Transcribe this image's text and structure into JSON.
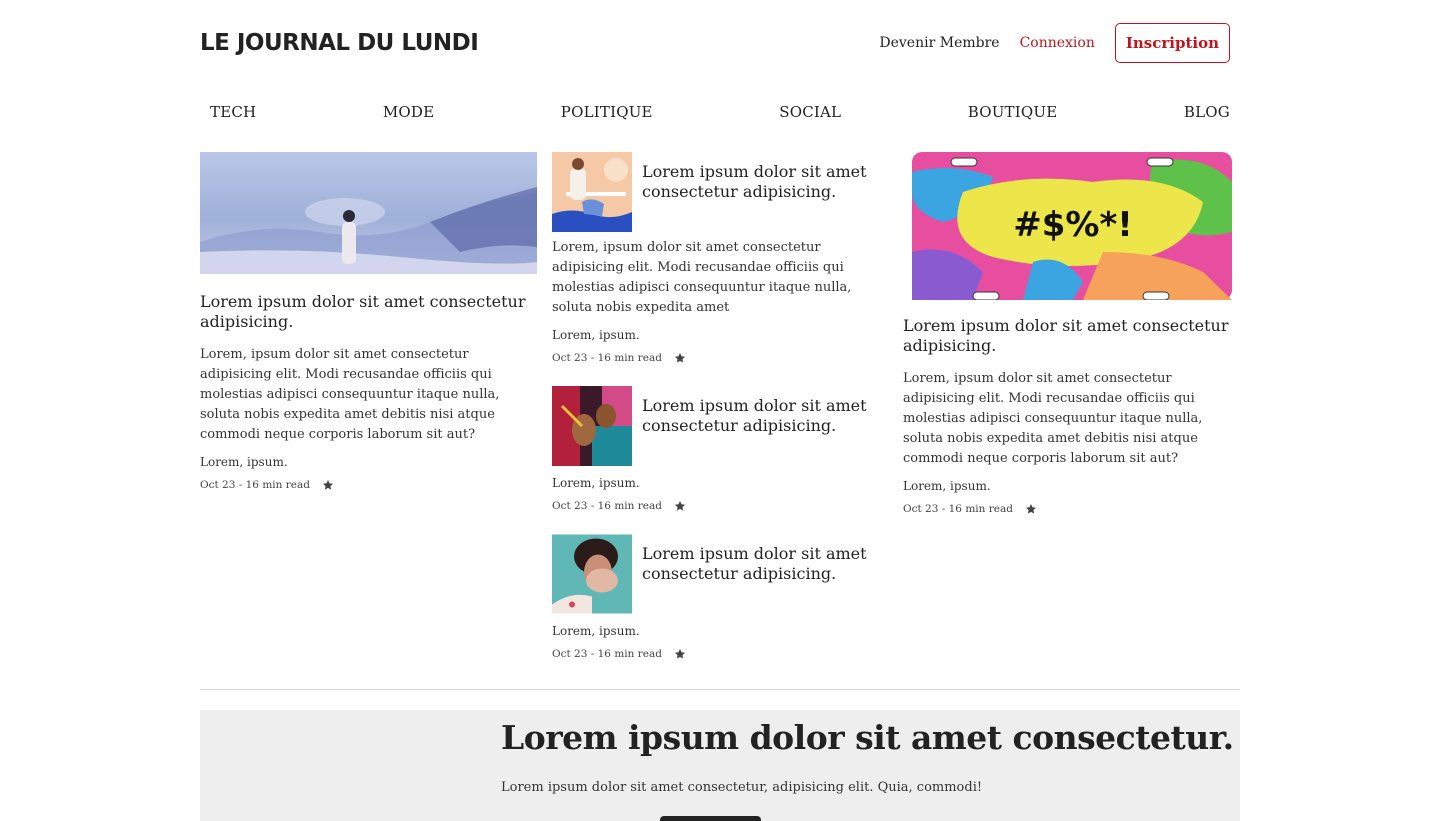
{
  "header": {
    "logo": "LE JOURNAL DU LUNDI",
    "member_link": "Devenir Membre",
    "login_link": "Connexion",
    "signup_button": "Inscription"
  },
  "nav": [
    "TECH",
    "MODE",
    "POLITIQUE",
    "SOCIAL",
    "BOUTIQUE",
    "BLOG"
  ],
  "colors": {
    "accent": "#c0141c",
    "text": "#222222",
    "newsletter_bg": "#eeeeee"
  },
  "featured_left": {
    "title": "Lorem ipsum dolor sit amet consectetur adipisicing.",
    "excerpt": "Lorem, ipsum dolor sit amet consectetur adipisicing elit. Modi recusandae officiis qui molestias adipisci consequuntur itaque nulla, soluta nobis expedita amet debitis nisi atque commodi neque corporis laborum sit aut?",
    "tags": "Lorem, ipsum.",
    "meta": "Oct 23 - 16 min read",
    "icon": "star-icon"
  },
  "middle": [
    {
      "title": "Lorem ipsum dolor sit amet consectetur adipisicing.",
      "excerpt": "Lorem, ipsum dolor sit amet consectetur adipisicing elit. Modi recusandae officiis qui molestias adipisci consequuntur itaque nulla, soluta nobis expedita amet",
      "tags": "Lorem, ipsum.",
      "meta": "Oct 23 - 16 min read"
    },
    {
      "title": "Lorem ipsum dolor sit amet consectetur adipisicing.",
      "tags": "Lorem, ipsum.",
      "meta": "Oct 23 - 16 min read"
    },
    {
      "title": "Lorem ipsum dolor sit amet consectetur adipisicing.",
      "tags": "Lorem, ipsum.",
      "meta": "Oct 23 - 16 min read"
    }
  ],
  "featured_right": {
    "image_text": "#$%*!",
    "title": "Lorem ipsum dolor sit amet consectetur adipisicing.",
    "excerpt": "Lorem, ipsum dolor sit amet consectetur adipisicing elit. Modi recusandae officiis qui molestias adipisci consequuntur itaque nulla, soluta nobis expedita amet debitis nisi atque commodi neque corporis laborum sit aut?",
    "tags": "Lorem, ipsum.",
    "meta": "Oct 23 - 16 min read"
  },
  "newsletter": {
    "title": "Lorem ipsum dolor sit amet consectetur.",
    "text": "Lorem ipsum dolor sit amet consectetur, adipisicing elit. Quia, commodi!"
  }
}
